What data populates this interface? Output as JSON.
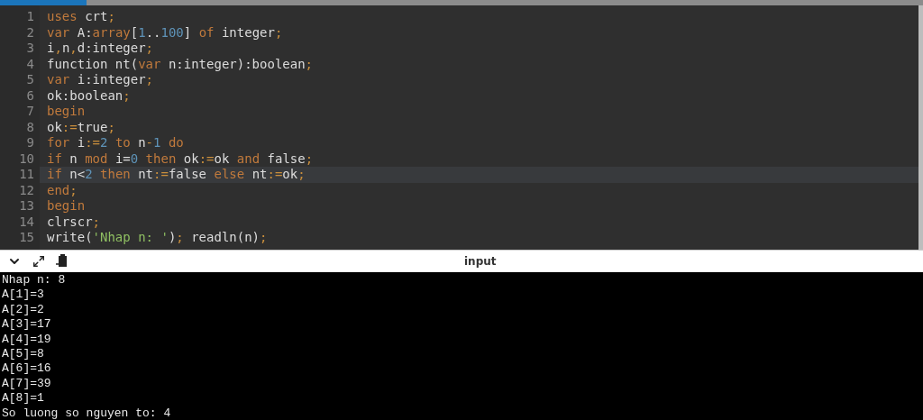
{
  "editor": {
    "lines": [
      {
        "number": "1",
        "current": false,
        "tokens": [
          {
            "kind": "kw",
            "text": "uses"
          },
          {
            "kind": "plain",
            "text": " crt"
          },
          {
            "kind": "punct",
            "text": ";"
          }
        ]
      },
      {
        "number": "2",
        "current": false,
        "tokens": [
          {
            "kind": "kw",
            "text": "var"
          },
          {
            "kind": "plain",
            "text": " A:"
          },
          {
            "kind": "kw",
            "text": "array"
          },
          {
            "kind": "plain",
            "text": "["
          },
          {
            "kind": "num",
            "text": "1"
          },
          {
            "kind": "plain",
            "text": ".."
          },
          {
            "kind": "num",
            "text": "100"
          },
          {
            "kind": "plain",
            "text": "] "
          },
          {
            "kind": "kw",
            "text": "of"
          },
          {
            "kind": "plain",
            "text": " integer"
          },
          {
            "kind": "punct",
            "text": ";"
          }
        ]
      },
      {
        "number": "3",
        "current": false,
        "tokens": [
          {
            "kind": "plain",
            "text": "i"
          },
          {
            "kind": "punct",
            "text": ","
          },
          {
            "kind": "plain",
            "text": "n"
          },
          {
            "kind": "punct",
            "text": ","
          },
          {
            "kind": "plain",
            "text": "d:integer"
          },
          {
            "kind": "punct",
            "text": ";"
          }
        ]
      },
      {
        "number": "4",
        "current": false,
        "tokens": [
          {
            "kind": "plain",
            "text": "function nt("
          },
          {
            "kind": "kw",
            "text": "var"
          },
          {
            "kind": "plain",
            "text": " n:integer):boolean"
          },
          {
            "kind": "punct",
            "text": ";"
          }
        ]
      },
      {
        "number": "5",
        "current": false,
        "tokens": [
          {
            "kind": "kw",
            "text": "var"
          },
          {
            "kind": "plain",
            "text": " i:integer"
          },
          {
            "kind": "punct",
            "text": ";"
          }
        ]
      },
      {
        "number": "6",
        "current": false,
        "tokens": [
          {
            "kind": "plain",
            "text": "ok:boolean"
          },
          {
            "kind": "punct",
            "text": ";"
          }
        ]
      },
      {
        "number": "7",
        "current": false,
        "tokens": [
          {
            "kind": "kw",
            "text": "begin"
          }
        ]
      },
      {
        "number": "8",
        "current": false,
        "tokens": [
          {
            "kind": "plain",
            "text": "ok"
          },
          {
            "kind": "punct",
            "text": ":="
          },
          {
            "kind": "plain",
            "text": "true"
          },
          {
            "kind": "punct",
            "text": ";"
          }
        ]
      },
      {
        "number": "9",
        "current": false,
        "tokens": [
          {
            "kind": "kw",
            "text": "for"
          },
          {
            "kind": "plain",
            "text": " i"
          },
          {
            "kind": "punct",
            "text": ":="
          },
          {
            "kind": "num",
            "text": "2"
          },
          {
            "kind": "kw",
            "text": " to"
          },
          {
            "kind": "plain",
            "text": " n"
          },
          {
            "kind": "punct",
            "text": "-"
          },
          {
            "kind": "num",
            "text": "1"
          },
          {
            "kind": "kw",
            "text": " do"
          }
        ]
      },
      {
        "number": "10",
        "current": false,
        "tokens": [
          {
            "kind": "kw",
            "text": "if"
          },
          {
            "kind": "plain",
            "text": " n "
          },
          {
            "kind": "kw",
            "text": "mod"
          },
          {
            "kind": "plain",
            "text": " i="
          },
          {
            "kind": "num",
            "text": "0"
          },
          {
            "kind": "kw",
            "text": " then"
          },
          {
            "kind": "plain",
            "text": " ok"
          },
          {
            "kind": "punct",
            "text": ":="
          },
          {
            "kind": "plain",
            "text": "ok "
          },
          {
            "kind": "kw",
            "text": "and"
          },
          {
            "kind": "plain",
            "text": " false"
          },
          {
            "kind": "punct",
            "text": ";"
          }
        ]
      },
      {
        "number": "11",
        "current": true,
        "tokens": [
          {
            "kind": "kw",
            "text": "if"
          },
          {
            "kind": "plain",
            "text": " n<"
          },
          {
            "kind": "num",
            "text": "2"
          },
          {
            "kind": "kw",
            "text": " then"
          },
          {
            "kind": "plain",
            "text": " nt"
          },
          {
            "kind": "punct",
            "text": ":="
          },
          {
            "kind": "plain",
            "text": "false "
          },
          {
            "kind": "kw",
            "text": "else"
          },
          {
            "kind": "plain",
            "text": " nt"
          },
          {
            "kind": "punct",
            "text": ":="
          },
          {
            "kind": "plain",
            "text": "ok"
          },
          {
            "kind": "punct",
            "text": ";"
          }
        ]
      },
      {
        "number": "12",
        "current": false,
        "tokens": [
          {
            "kind": "kw",
            "text": "end"
          },
          {
            "kind": "punct",
            "text": ";"
          }
        ]
      },
      {
        "number": "13",
        "current": false,
        "tokens": [
          {
            "kind": "kw",
            "text": "begin"
          }
        ]
      },
      {
        "number": "14",
        "current": false,
        "tokens": [
          {
            "kind": "plain",
            "text": "clrscr"
          },
          {
            "kind": "punct",
            "text": ";"
          }
        ]
      },
      {
        "number": "15",
        "current": false,
        "tokens": [
          {
            "kind": "plain",
            "text": "write("
          },
          {
            "kind": "str",
            "text": "'Nhap n: '"
          },
          {
            "kind": "plain",
            "text": ")"
          },
          {
            "kind": "punct",
            "text": ";"
          },
          {
            "kind": "plain",
            "text": " readln(n)"
          },
          {
            "kind": "punct",
            "text": ";"
          }
        ]
      }
    ]
  },
  "console": {
    "title": "input",
    "lines": [
      "Nhap n: 8",
      "A[1]=3",
      "A[2]=2",
      "A[3]=17",
      "A[4]=19",
      "A[5]=8",
      "A[6]=16",
      "A[7]=39",
      "A[8]=1",
      "So luong so nguyen to: 4"
    ]
  }
}
